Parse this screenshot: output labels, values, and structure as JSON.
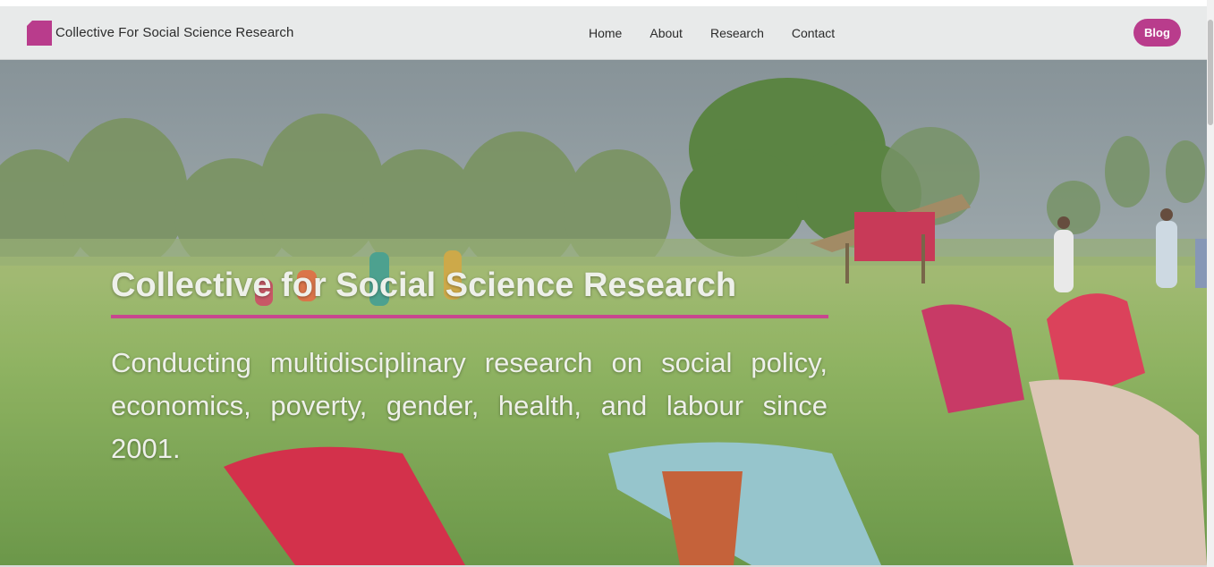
{
  "header": {
    "brand_name": "Collective For Social Science Research",
    "logo_icon": "magenta-square-logo-icon",
    "nav": [
      {
        "label": "Home"
      },
      {
        "label": "About"
      },
      {
        "label": "Research"
      },
      {
        "label": "Contact"
      }
    ],
    "blog_label": "Blog"
  },
  "hero": {
    "title": "Collective for Social Science Research",
    "description": "Conducting multidisciplinary research on social policy, economics, poverty, gender, health, and labour since 2001.",
    "background": "field-workers-photo"
  },
  "colors": {
    "accent": "#b93c8c",
    "rule": "#c8468f",
    "nav_bg": "#e8eaea"
  }
}
